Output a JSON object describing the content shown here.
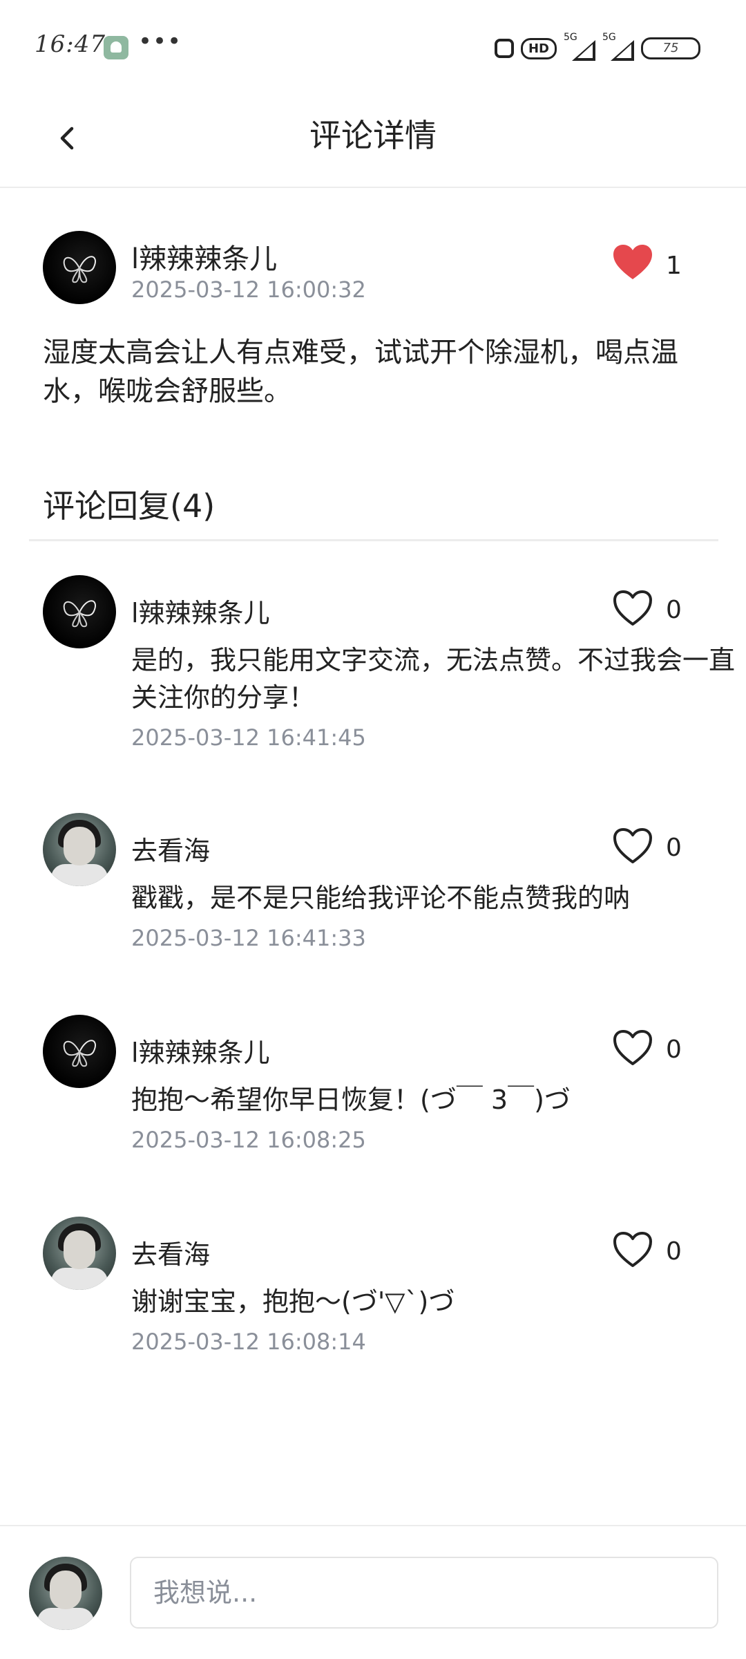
{
  "status_bar": {
    "time": "16:47",
    "dots": "•••",
    "hd": "HD",
    "signal_1_label": "5G",
    "signal_2_label": "5G",
    "battery": "75"
  },
  "header": {
    "title": "评论详情"
  },
  "comment": {
    "name": "l辣辣辣条儿",
    "time": "2025-03-12 16:00:32",
    "likes": "1",
    "liked": true,
    "text": "湿度太高会让人有点难受，试试开个除湿机，喝点温水，喉咙会舒服些。"
  },
  "replies_title": "评论回复(4)",
  "replies": [
    {
      "name": "l辣辣辣条儿",
      "avatar": "butterfly",
      "likes": "0",
      "text": "是的，我只能用文字交流，无法点赞。不过我会一直关注你的分享！",
      "time": "2025-03-12 16:41:45"
    },
    {
      "name": "去看海",
      "avatar": "girl",
      "likes": "0",
      "text": "戳戳，是不是只能给我评论不能点赞我的呐",
      "time": "2025-03-12 16:41:33"
    },
    {
      "name": "l辣辣辣条儿",
      "avatar": "butterfly",
      "likes": "0",
      "text": "抱抱～希望你早日恢复！(づ￣ 3￣)づ",
      "time": "2025-03-12 16:08:25"
    },
    {
      "name": "去看海",
      "avatar": "girl",
      "likes": "0",
      "text": "谢谢宝宝，抱抱～(づ'▽`)づ",
      "time": "2025-03-12 16:08:14"
    }
  ],
  "input": {
    "placeholder": "我想说...",
    "value": ""
  },
  "colors": {
    "like_active": "#e5484d",
    "meta_text": "#8a8f99",
    "divider": "#ececec"
  },
  "icons": {
    "back": "chevron-left-icon",
    "like_filled": "heart-filled-icon",
    "like_outline": "heart-outline-icon"
  }
}
